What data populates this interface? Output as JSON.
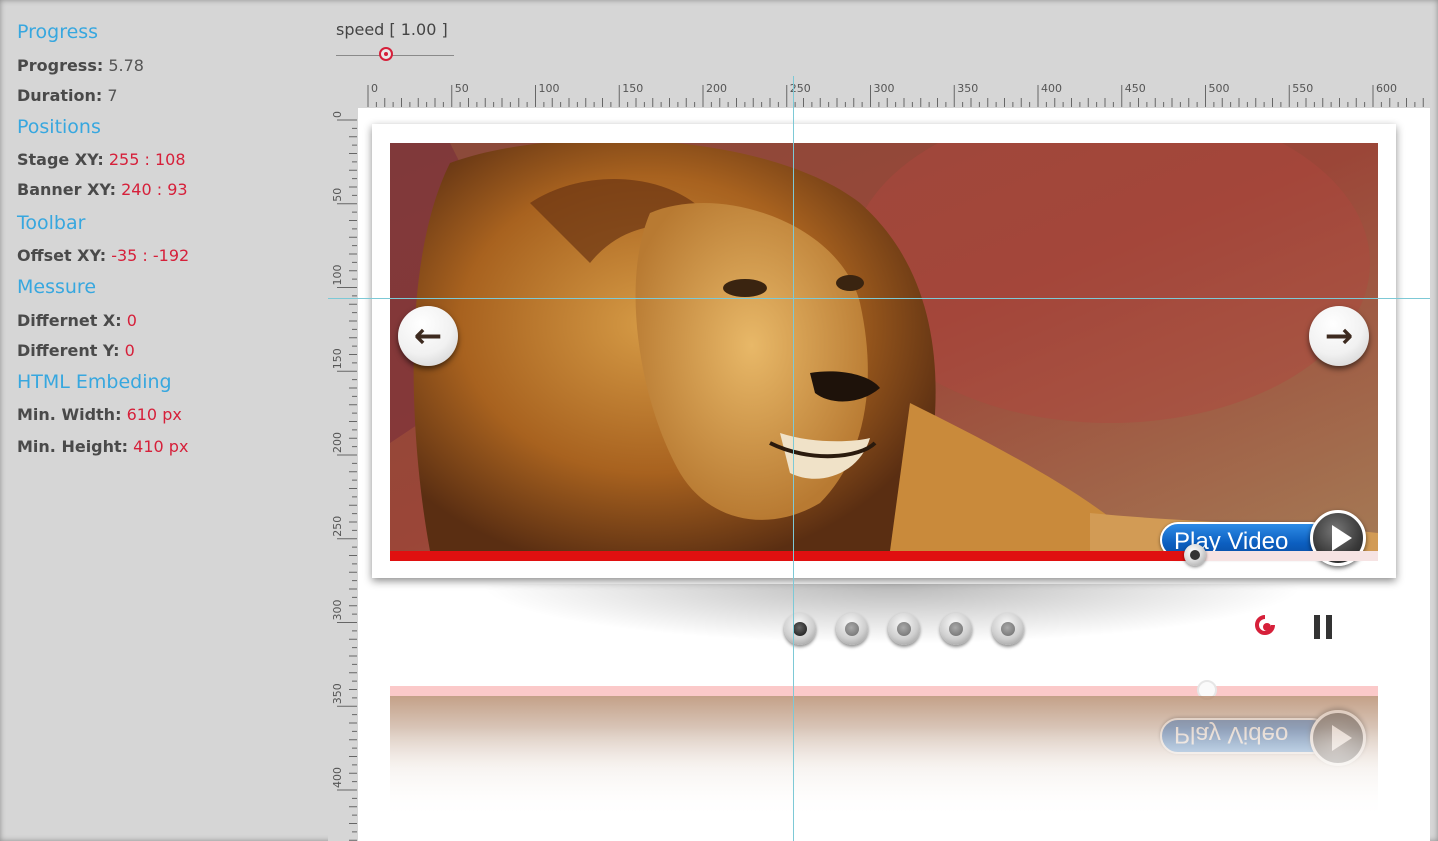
{
  "panel": {
    "progress": {
      "title": "Progress",
      "progress_label": "Progress:",
      "progress_value": "5.78",
      "duration_label": "Duration:",
      "duration_value": "7"
    },
    "positions": {
      "title": "Positions",
      "stage_label": "Stage XY:",
      "stage_value": "255 : 108",
      "banner_label": "Banner XY:",
      "banner_value": "240 : 93"
    },
    "toolbar": {
      "title": "Toolbar",
      "offset_label": "Offset XY:",
      "offset_value": "-35 : -192"
    },
    "messure": {
      "title": "Messure",
      "diffx_label": "Differnet X:",
      "diffx_value": "0",
      "diffy_label": "Different Y:",
      "diffy_value": "0"
    },
    "embed": {
      "title": "HTML Embeding",
      "minw_label": "Min. Width:",
      "minw_value": "610 px",
      "minh_label": "Min. Height:",
      "minh_value": "410 px"
    }
  },
  "speed": {
    "label": "speed [ 1.00 ]",
    "value": 1.0,
    "fraction": 0.43
  },
  "ruler": {
    "top_labels": [
      "0",
      "50",
      "100",
      "150",
      "200",
      "250",
      "300",
      "350",
      "400",
      "450",
      "500",
      "550",
      "600"
    ],
    "left_labels": [
      "0",
      "50",
      "100",
      "150",
      "200",
      "250",
      "300",
      "350",
      "400"
    ]
  },
  "banner": {
    "play_video_label": "Play Video",
    "reflection_label": "Play Video",
    "progress_fraction": 0.815,
    "slide_count": 5,
    "active_slide": 0,
    "prev_icon": "arrow-left-icon",
    "next_icon": "arrow-right-icon",
    "colors": {
      "accent": "#37a7df",
      "value_red": "#d6203a",
      "progress_red": "#e01010",
      "button_blue": "#0c5fc0",
      "guide": "#7dc9d6"
    }
  }
}
